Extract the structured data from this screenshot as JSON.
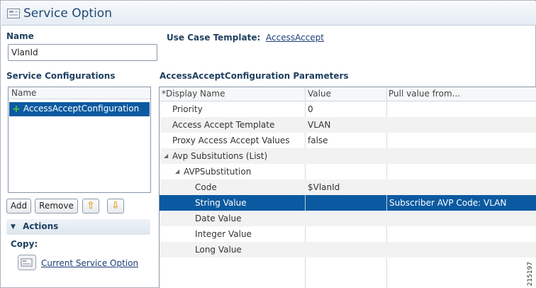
{
  "window": {
    "title": "Service Option"
  },
  "name_section": {
    "label": "Name",
    "value": "VlanId"
  },
  "use_case": {
    "label": "Use Case Template:",
    "link": "AccessAccept"
  },
  "service_configurations": {
    "label": "Service Configurations",
    "column_header": "Name",
    "items": [
      "AccessAcceptConfiguration"
    ]
  },
  "buttons": {
    "add": "Add",
    "remove": "Remove",
    "up_glyph": "⇧",
    "down_glyph": "⇩"
  },
  "actions": {
    "header": "Actions",
    "copy_label": "Copy:",
    "copy_link": "Current Service Option"
  },
  "parameters": {
    "title": "AccessAcceptConfiguration Parameters",
    "columns": [
      "*Display Name",
      "Value",
      "Pull value from..."
    ],
    "rows": [
      {
        "name": "Priority",
        "value": "0",
        "pull": ""
      },
      {
        "name": "Access Accept Template",
        "value": "VLAN",
        "pull": ""
      },
      {
        "name": "Proxy Access Accept Values",
        "value": "false",
        "pull": ""
      },
      {
        "name": "Avp Subsitutions (List)",
        "value": "",
        "pull": ""
      },
      {
        "name": "AVPSubstitution",
        "value": "",
        "pull": ""
      },
      {
        "name": "Code",
        "value": "$VlanId",
        "pull": ""
      },
      {
        "name": "String Value",
        "value": "",
        "pull": "Subscriber AVP Code: VLAN"
      },
      {
        "name": "Date Value",
        "value": "",
        "pull": ""
      },
      {
        "name": "Integer Value",
        "value": "",
        "pull": ""
      },
      {
        "name": "Long Value",
        "value": "",
        "pull": ""
      }
    ]
  },
  "figure_number": "215197",
  "colors": {
    "selection": "#0b5aa1",
    "title": "#1f4a72",
    "plus": "#58c43a",
    "arrow": "#e6a21a"
  }
}
